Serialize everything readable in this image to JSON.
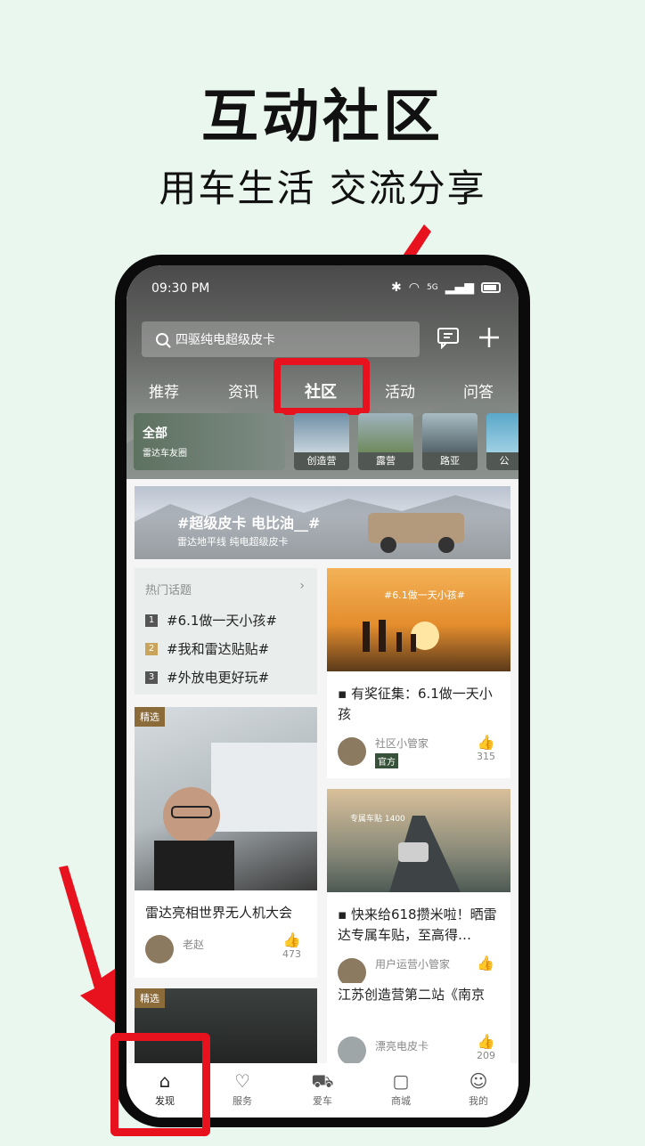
{
  "promo": {
    "headline": "互动社区",
    "subline": "用车生活 交流分享"
  },
  "status": {
    "time": "09:30 PM",
    "signal": "5G"
  },
  "search": {
    "placeholder": "四驱纯电超级皮卡"
  },
  "tabs": [
    "推荐",
    "资讯",
    "社区",
    "活动",
    "问答"
  ],
  "active_tab": "社区",
  "circles": {
    "all_title": "全部",
    "all_sub": "雷达车友圈",
    "items": [
      "创造营",
      "露营",
      "路亚",
      "公"
    ]
  },
  "banner": {
    "title": "#超级皮卡 电比油__#",
    "subtitle": "雷达地平线 纯电超级皮卡"
  },
  "hot_topics": {
    "header": "热门话题",
    "items": [
      {
        "rank": "1",
        "text": "#6.1做一天小孩#"
      },
      {
        "rank": "2",
        "text": "#我和雷达贴贴#"
      },
      {
        "rank": "3",
        "text": "#外放电更好玩#"
      }
    ]
  },
  "feed": {
    "featured_tag": "精选",
    "card1": {
      "title": "雷达亮相世界无人机大会",
      "user": "老赵",
      "likes": "473"
    },
    "card2": {
      "img_text": "#6.1做一天小孩#",
      "title": "有奖征集：6.1做一天小孩",
      "user": "社区小管家",
      "badge": "官方",
      "likes": "315"
    },
    "card3": {
      "img_text": "专属车贴 1400",
      "title": "快来给618攒米啦！晒雷达专属车贴，至高得…",
      "user": "用户运营小管家"
    },
    "card4": {
      "title": "江苏创造营第二站《南京",
      "user": "漂亮电皮卡",
      "likes": "209"
    },
    "card5_tag": "精选"
  },
  "nav": [
    "发现",
    "服务",
    "爱车",
    "商城",
    "我的"
  ],
  "colors": {
    "highlight": "#e8121f",
    "background": "#e9f7ee"
  }
}
